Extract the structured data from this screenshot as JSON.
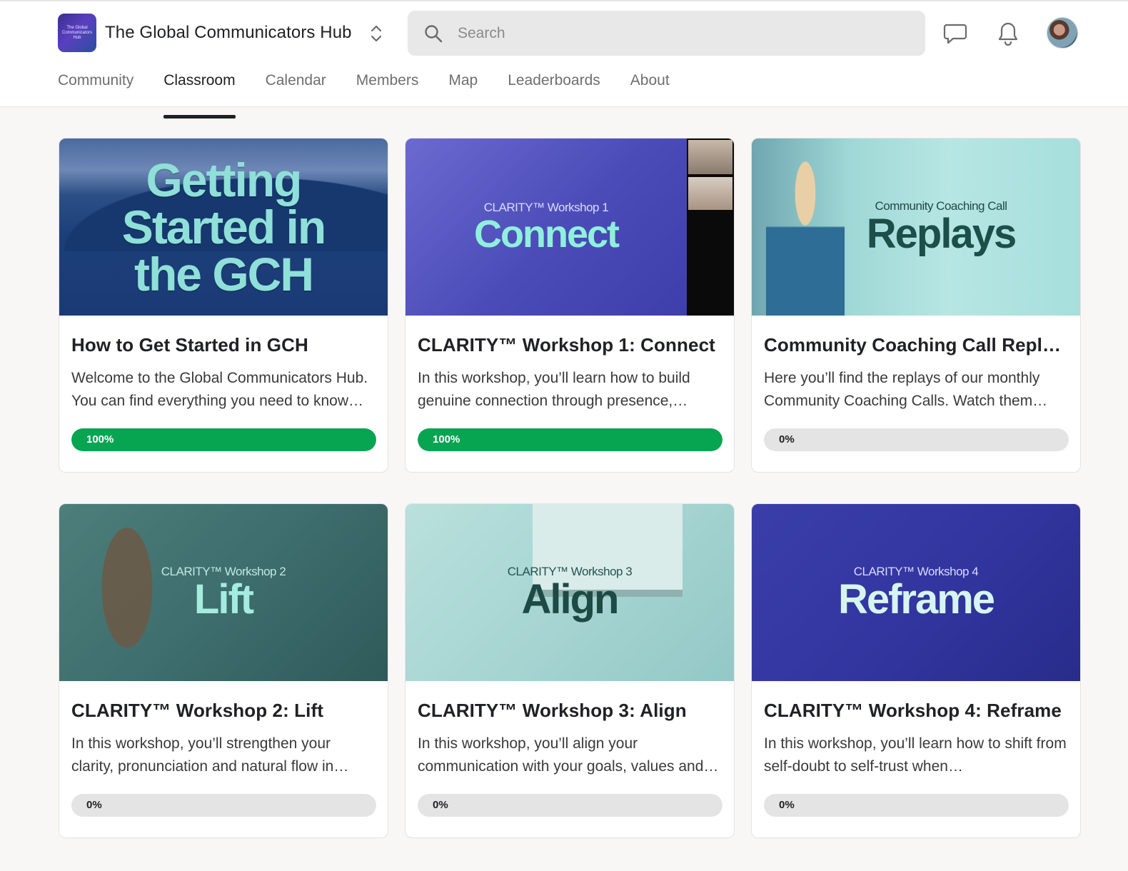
{
  "app": {
    "logo_text": "The Global Communicators Hub",
    "name": "The Global Communicators Hub"
  },
  "search": {
    "placeholder": "Search",
    "value": ""
  },
  "header_icons": [
    "chat-icon",
    "bell-icon",
    "avatar"
  ],
  "tabs": [
    {
      "label": "Community",
      "active": false
    },
    {
      "label": "Classroom",
      "active": true
    },
    {
      "label": "Calendar",
      "active": false
    },
    {
      "label": "Members",
      "active": false
    },
    {
      "label": "Map",
      "active": false
    },
    {
      "label": "Leaderboards",
      "active": false
    },
    {
      "label": "About",
      "active": false
    }
  ],
  "colors": {
    "progress_complete": "#07a452",
    "progress_track": "#e4e4e4"
  },
  "courses": [
    {
      "thumb_sub": "",
      "thumb_title": "Getting Started in the GCH",
      "title": "How to Get Started in GCH",
      "description": "Welcome to the Global Communicators Hub. You can find everything you need to know…",
      "progress": 100,
      "progress_label": "100%"
    },
    {
      "thumb_sub": "CLARITY™ Workshop 1",
      "thumb_title": "Connect",
      "title": "CLARITY™ Workshop 1: Connect",
      "description": "In this workshop, you’ll learn how to build genuine connection through presence,…",
      "progress": 100,
      "progress_label": "100%"
    },
    {
      "thumb_sub": "Community Coaching Call",
      "thumb_title": "Replays",
      "title": "Community Coaching Call Replay…",
      "description": "Here you’ll find the replays of our monthly Community Coaching Calls. Watch them…",
      "progress": 0,
      "progress_label": "0%"
    },
    {
      "thumb_sub": "CLARITY™ Workshop 2",
      "thumb_title": "Lift",
      "title": "CLARITY™ Workshop 2: Lift",
      "description": "In this workshop, you’ll strengthen your clarity, pronunciation and natural flow in…",
      "progress": 0,
      "progress_label": "0%"
    },
    {
      "thumb_sub": "CLARITY™ Workshop 3",
      "thumb_title": "Align",
      "title": "CLARITY™ Workshop 3: Align",
      "description": "In this workshop, you’ll align your communication with your goals, values and…",
      "progress": 0,
      "progress_label": "0%"
    },
    {
      "thumb_sub": "CLARITY™ Workshop 4",
      "thumb_title": "Reframe",
      "title": "CLARITY™ Workshop 4: Reframe",
      "description": "In this workshop, you’ll learn how to shift from self-doubt to self-trust when…",
      "progress": 0,
      "progress_label": "0%"
    }
  ]
}
